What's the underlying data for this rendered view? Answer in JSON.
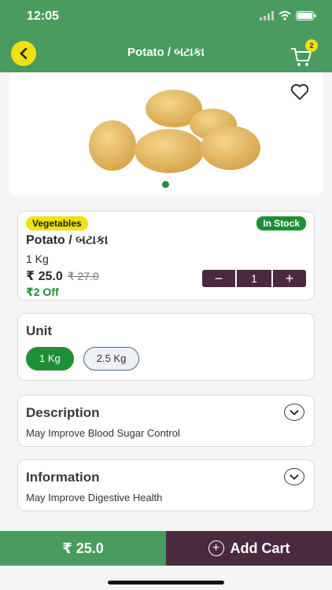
{
  "status_bar": {
    "time": "12:05"
  },
  "nav": {
    "title": "Potato / બટાકા",
    "cart_count": "2"
  },
  "product": {
    "category": "Vegetables",
    "stock": "In Stock",
    "name": "Potato / બટાકા",
    "weight": "1 Kg",
    "price": "₹ 25.0",
    "mrp": "₹ 27.0",
    "discount": "₹2 Off",
    "quantity": "1"
  },
  "unit": {
    "title": "Unit",
    "options": [
      "1 Kg",
      "2.5 Kg"
    ],
    "selected": "1 Kg"
  },
  "description": {
    "title": "Description",
    "text": "May Improve Blood Sugar Control"
  },
  "information": {
    "title": "Information",
    "text": "May Improve Digestive Health"
  },
  "bottom": {
    "total": "₹ 25.0",
    "add_cart_label": "Add Cart"
  },
  "colors": {
    "primary_green": "#4a9b5f",
    "accent_yellow": "#f1e012",
    "dark_plum": "#4a2a3f",
    "stock_green": "#1f8f36"
  }
}
